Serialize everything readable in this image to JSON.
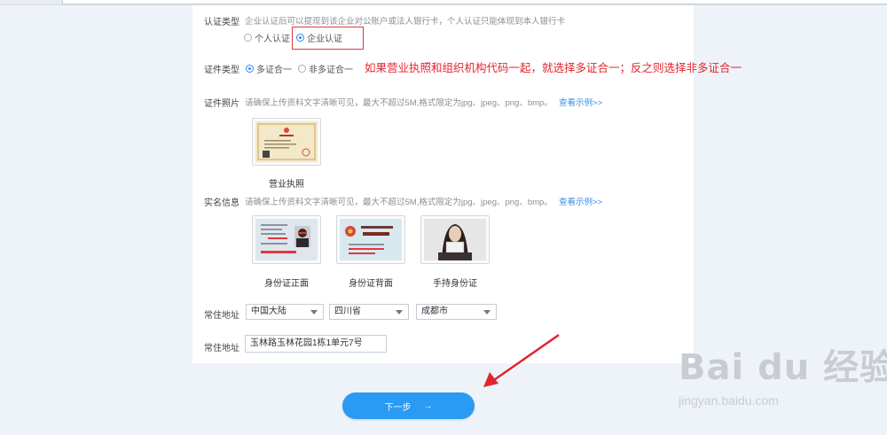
{
  "cert_type": {
    "label": "认证类型",
    "hint": "企业认证后可以提现到该企业对公账户或法人银行卡，个人认证只能体现到本人银行卡",
    "options": [
      "个人认证",
      "企业认证"
    ],
    "selected": "企业认证"
  },
  "id_type": {
    "label": "证件类型",
    "options": [
      "多证合一",
      "非多证合一"
    ],
    "selected": "多证合一"
  },
  "annotation": "如果营业执照和组织机构代码一起，就选择多证合一；反之则选择非多证合一",
  "cert_photo": {
    "label": "证件照片",
    "hint": "请确保上传资料文字清晰可见，最大不超过5M,格式限定为jpg、jpeg、png、bmp。",
    "link": "查看示例>>",
    "items": [
      "营业执照"
    ]
  },
  "realname": {
    "label": "实名信息",
    "hint": "请确保上传资料文字清晰可见，最大不超过5M,格式限定为jpg、jpeg、png、bmp。",
    "link": "查看示例>>",
    "items": [
      "身份证正面",
      "身份证背面",
      "手持身份证"
    ]
  },
  "address": {
    "label": "常住地址",
    "country": "中国大陆",
    "province": "四川省",
    "city": "成都市"
  },
  "street": {
    "label": "常住地址",
    "value": "玉林路玉林花园1栋1单元7号"
  },
  "next_button": {
    "label": "下一步",
    "arrow": "→"
  },
  "watermark": {
    "brand": "Bai du 经验",
    "url": "jingyan.baidu.com"
  },
  "colors": {
    "primary": "#2b9af3",
    "annotation_red": "#e3262d",
    "background": "#eef3fa"
  }
}
